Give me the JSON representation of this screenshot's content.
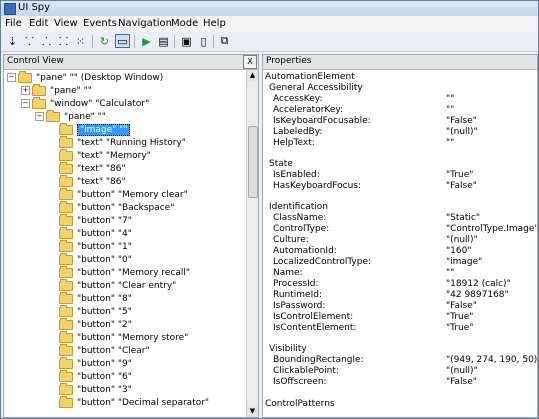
{
  "window": {
    "title": "UI Spy"
  },
  "menu": [
    "File",
    "Edit",
    "View",
    "Events",
    "Navigation",
    "Mode",
    "Help"
  ],
  "left_panel": {
    "title": "Control View",
    "close_label": "X",
    "tree": [
      {
        "label": "\"pane\" \"\" (Desktop Window)"
      },
      {
        "label": "\"pane\" \"\""
      },
      {
        "label": "\"window\" \"Calculator\""
      },
      {
        "label": "\"pane\" \"\""
      },
      {
        "label": "\"image\" \"\""
      },
      {
        "label": "\"text\" \"Running History\""
      },
      {
        "label": "\"text\" \"Memory\""
      },
      {
        "label": "\"text\" \"86\""
      },
      {
        "label": "\"text\" \"86\""
      },
      {
        "label": "\"button\" \"Memory clear\""
      },
      {
        "label": "\"button\" \"Backspace\""
      },
      {
        "label": "\"button\" \"7\""
      },
      {
        "label": "\"button\" \"4\""
      },
      {
        "label": "\"button\" \"1\""
      },
      {
        "label": "\"button\" \"0\""
      },
      {
        "label": "\"button\" \"Memory recall\""
      },
      {
        "label": "\"button\" \"Clear entry\""
      },
      {
        "label": "\"button\" \"8\""
      },
      {
        "label": "\"button\" \"5\""
      },
      {
        "label": "\"button\" \"2\""
      },
      {
        "label": "\"button\" \"Memory store\""
      },
      {
        "label": "\"button\" \"Clear\""
      },
      {
        "label": "\"button\" \"9\""
      },
      {
        "label": "\"button\" \"6\""
      },
      {
        "label": "\"button\" \"3\""
      },
      {
        "label": "\"button\" \"Decimal separator\""
      }
    ]
  },
  "right_panel": {
    "title": "Properties",
    "lines": [
      {
        "label": "AutomationElement",
        "value": ""
      },
      {
        "label": "General Accessibility",
        "value": ""
      },
      {
        "label": "AccessKey:",
        "value": "\"\""
      },
      {
        "label": "AcceleratorKey:",
        "value": "\"\""
      },
      {
        "label": "IsKeyboardFocusable:",
        "value": "\"False\""
      },
      {
        "label": "LabeledBy:",
        "value": "\"(null)\""
      },
      {
        "label": "HelpText:",
        "value": "\"\""
      },
      {
        "label": "State",
        "value": ""
      },
      {
        "label": "IsEnabled:",
        "value": "\"True\""
      },
      {
        "label": "HasKeyboardFocus:",
        "value": "\"False\""
      },
      {
        "label": "Identification",
        "value": ""
      },
      {
        "label": "ClassName:",
        "value": "\"Static\""
      },
      {
        "label": "ControlType:",
        "value": "\"ControlType.Image\""
      },
      {
        "label": "Culture:",
        "value": "\"(null)\""
      },
      {
        "label": "AutomationId:",
        "value": "\"160\""
      },
      {
        "label": "LocalizedControlType:",
        "value": "\"image\""
      },
      {
        "label": "Name:",
        "value": "\"\""
      },
      {
        "label": "ProcessId:",
        "value": "\"18912 (calc)\""
      },
      {
        "label": "RuntimeId:",
        "value": "\"42 9897168\""
      },
      {
        "label": "IsPassword:",
        "value": "\"False\""
      },
      {
        "label": "IsControlElement:",
        "value": "\"True\""
      },
      {
        "label": "IsContentElement:",
        "value": "\"True\""
      },
      {
        "label": "Visibility",
        "value": ""
      },
      {
        "label": "BoundingRectangle:",
        "value": "\"(949, 274, 190, 50)\""
      },
      {
        "label": "ClickablePoint:",
        "value": "\"(null)\""
      },
      {
        "label": "IsOffscreen:",
        "value": "\"False\""
      },
      {
        "label": "ControlPatterns",
        "value": ""
      }
    ]
  },
  "colors": {
    "selection": "#3399ff",
    "folder": "#f3d16b"
  }
}
